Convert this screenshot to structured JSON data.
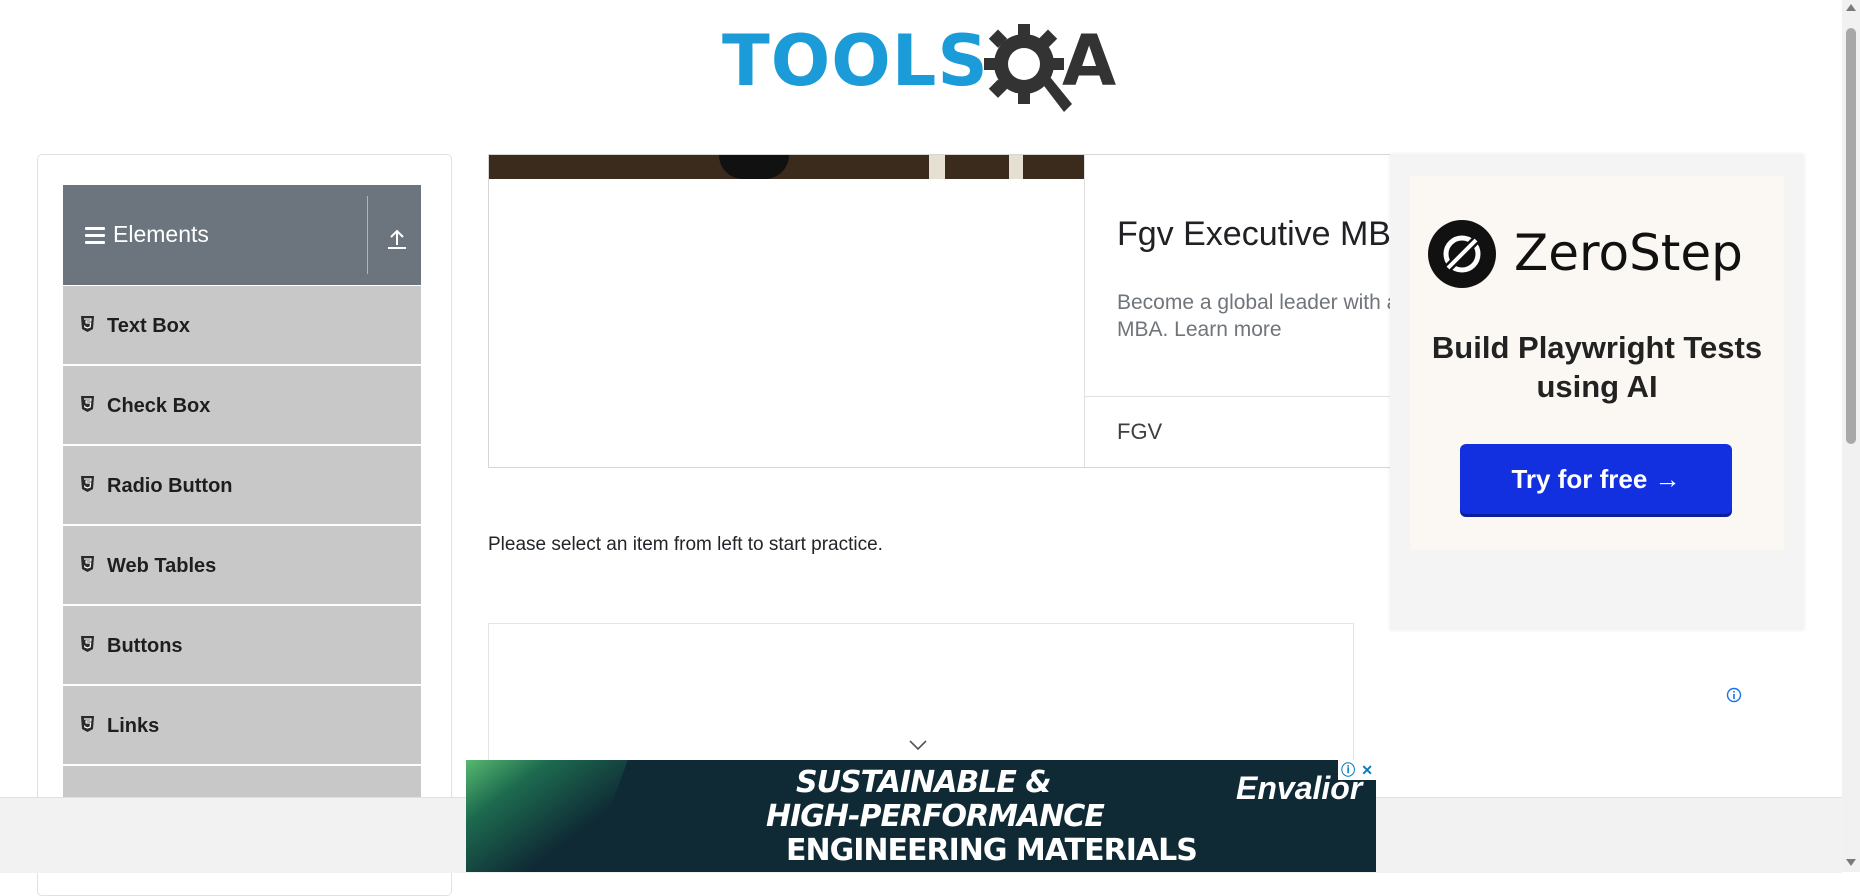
{
  "header": {
    "logo_text": "TOOLS",
    "logo_suffix": "A"
  },
  "sidebar": {
    "group_title": "Elements",
    "items": [
      {
        "label": "Text Box"
      },
      {
        "label": "Check Box"
      },
      {
        "label": "Radio Button"
      },
      {
        "label": "Web Tables"
      },
      {
        "label": "Buttons"
      },
      {
        "label": "Links"
      },
      {
        "label": ""
      }
    ]
  },
  "ad": {
    "title": "Fgv Executive MBA",
    "description": "Become a global leader with an internationally recognized MBA. Learn more",
    "advertiser": "FGV"
  },
  "main": {
    "instruction": "Please select an item from left to start practice."
  },
  "side_ad": {
    "brand": "ZeroStep",
    "tagline": "Build Playwright Tests using AI",
    "cta": "Try for free →"
  },
  "banner": {
    "line1": "SUSTAINABLE &",
    "line2": "HIGH-PERFORMANCE",
    "line3": "ENGINEERING MATERIALS",
    "brand": "Envalior"
  },
  "colors": {
    "brand_blue": "#1b9bd7",
    "sidebar_header": "#6c757d",
    "menu_item_bg": "#c8c8c8",
    "cta_blue": "#1330e0"
  }
}
